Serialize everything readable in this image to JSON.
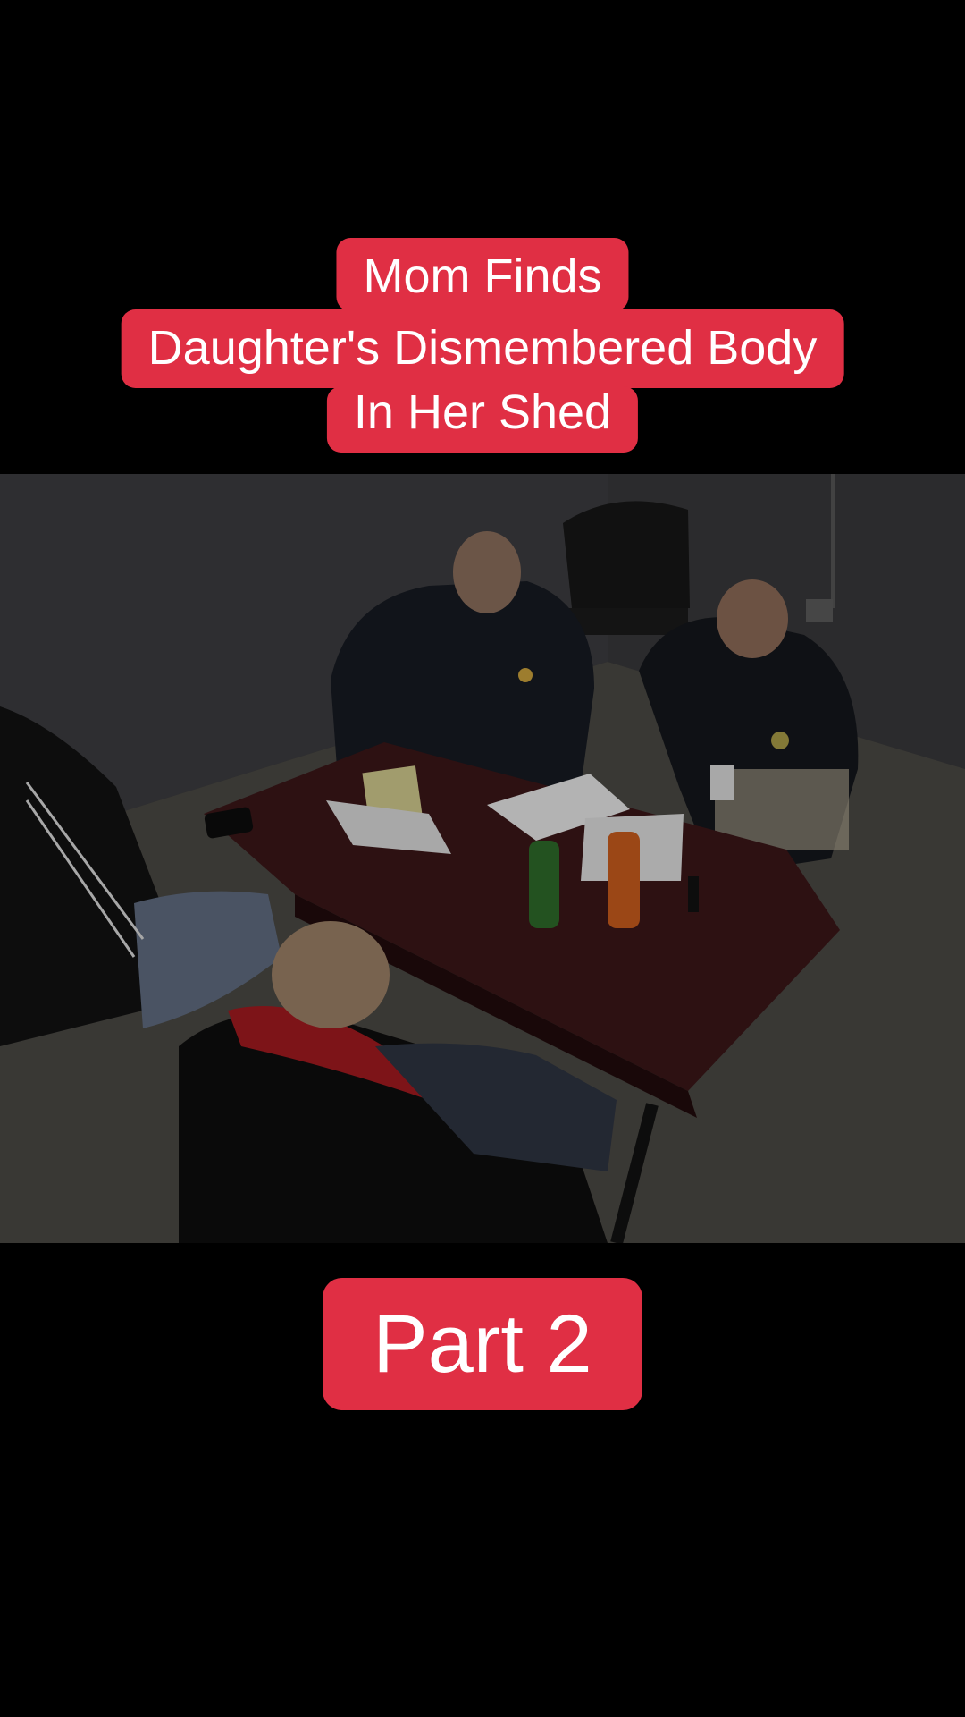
{
  "caption": {
    "line1": "Mom Finds",
    "line2": "Daughter's Dismembered Body",
    "line3": "In Her Shed"
  },
  "video": {
    "scene": "interview-room"
  },
  "badge": {
    "label": "Part 2"
  },
  "colors": {
    "accent": "#e02f44",
    "background": "#000000"
  }
}
